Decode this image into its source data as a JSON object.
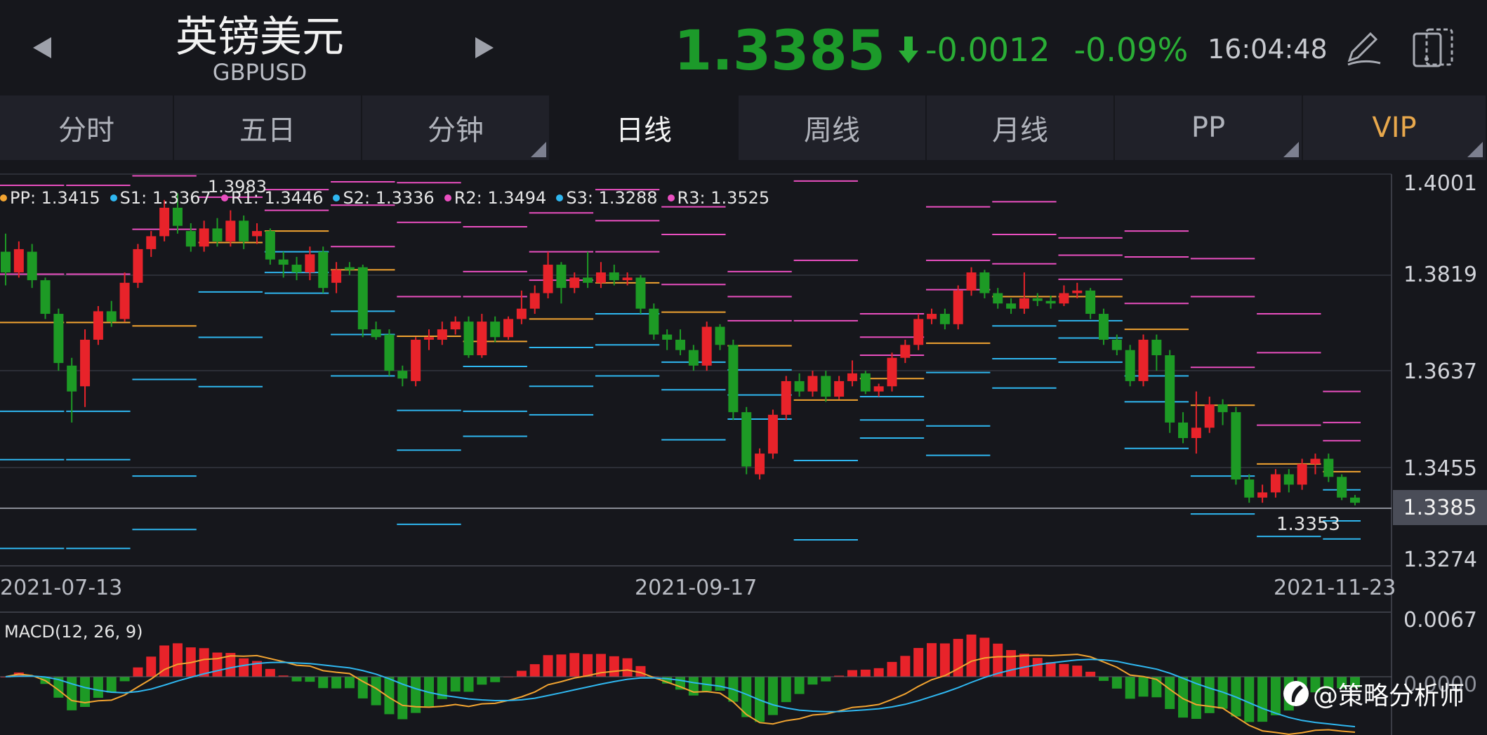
{
  "header": {
    "title": "英镑美元",
    "symbol": "GBPUSD",
    "price": "1.3385",
    "change": "-0.0012",
    "change_pct": "-0.09%",
    "time": "16:04:48"
  },
  "tabs": [
    {
      "label": "分时",
      "corner": false
    },
    {
      "label": "五日",
      "corner": false
    },
    {
      "label": "分钟",
      "corner": true
    },
    {
      "label": "日线",
      "corner": false,
      "active": true
    },
    {
      "label": "周线",
      "corner": false
    },
    {
      "label": "月线",
      "corner": false
    },
    {
      "label": "PP",
      "corner": true
    },
    {
      "label": "VIP",
      "corner": true
    }
  ],
  "pp_legend": [
    {
      "text": "PP: 1.3415",
      "color": "#f2a431"
    },
    {
      "text": "S1: 1.3367",
      "color": "#2fb7f0"
    },
    {
      "text": "R1: 1.3446",
      "color": "#ea4fc0"
    },
    {
      "text": "S2: 1.3336",
      "color": "#2fb7f0"
    },
    {
      "text": "R2: 1.3494",
      "color": "#ea4fc0"
    },
    {
      "text": "S3: 1.3288",
      "color": "#2fb7f0"
    },
    {
      "text": "R3: 1.3525",
      "color": "#ea4fc0"
    }
  ],
  "price_axis": [
    "1.4001",
    "1.3819",
    "1.3637",
    "1.3455",
    "1.3274"
  ],
  "current_price_label": "1.3385",
  "high_label": "1.3983",
  "low_label": "1.3353",
  "date_ticks": [
    "2021-07-13",
    "2021-09-17",
    "2021-11-23"
  ],
  "macd": {
    "label": "MACD(12, 26, 9)",
    "axis_top": "0.0067",
    "axis_zero": "0.0000"
  },
  "watermark": "@策略分析师",
  "colors": {
    "up": "#e8232a",
    "down": "#1d9a25",
    "pp": "#f2a431",
    "support": "#2fb7f0",
    "resistance": "#ea4fc0",
    "price_green": "#1c9a2a"
  },
  "chart_data": {
    "type": "candlestick",
    "ylim": [
      1.3274,
      1.4001
    ],
    "candles": [
      [
        1.387,
        1.383,
        1.3905,
        1.3805
      ],
      [
        1.383,
        1.3875,
        1.389,
        1.382
      ],
      [
        1.387,
        1.3815,
        1.3885,
        1.38
      ],
      [
        1.3815,
        1.375,
        1.382,
        1.374
      ],
      [
        1.375,
        1.3655,
        1.376,
        1.364
      ],
      [
        1.365,
        1.36,
        1.3665,
        1.354
      ],
      [
        1.361,
        1.37,
        1.372,
        1.357
      ],
      [
        1.37,
        1.3755,
        1.3765,
        1.369
      ],
      [
        1.3755,
        1.3735,
        1.3775,
        1.3725
      ],
      [
        1.374,
        1.381,
        1.383,
        1.3735
      ],
      [
        1.381,
        1.3875,
        1.3885,
        1.38
      ],
      [
        1.3875,
        1.39,
        1.391,
        1.386
      ],
      [
        1.39,
        1.3955,
        1.397,
        1.389
      ],
      [
        1.3955,
        1.392,
        1.3983,
        1.3905
      ],
      [
        1.391,
        1.388,
        1.3925,
        1.387
      ],
      [
        1.388,
        1.3915,
        1.393,
        1.387
      ],
      [
        1.3915,
        1.389,
        1.3935,
        1.388
      ],
      [
        1.389,
        1.393,
        1.395,
        1.388
      ],
      [
        1.393,
        1.389,
        1.394,
        1.3875
      ],
      [
        1.39,
        1.391,
        1.3925,
        1.3885
      ],
      [
        1.391,
        1.3855,
        1.3915,
        1.3845
      ],
      [
        1.3855,
        1.3845,
        1.387,
        1.382
      ],
      [
        1.3845,
        1.383,
        1.386,
        1.3815
      ],
      [
        1.383,
        1.3865,
        1.388,
        1.3815
      ],
      [
        1.387,
        1.38,
        1.388,
        1.379
      ],
      [
        1.381,
        1.3835,
        1.385,
        1.379
      ],
      [
        1.384,
        1.3835,
        1.385,
        1.3825
      ],
      [
        1.384,
        1.372,
        1.3845,
        1.3705
      ],
      [
        1.372,
        1.3705,
        1.3735,
        1.37
      ],
      [
        1.371,
        1.364,
        1.372,
        1.363
      ],
      [
        1.364,
        1.3625,
        1.365,
        1.361
      ],
      [
        1.362,
        1.37,
        1.3705,
        1.361
      ],
      [
        1.37,
        1.3705,
        1.372,
        1.368
      ],
      [
        1.37,
        1.372,
        1.3735,
        1.369
      ],
      [
        1.372,
        1.3735,
        1.3745,
        1.371
      ],
      [
        1.3735,
        1.367,
        1.3745,
        1.3665
      ],
      [
        1.367,
        1.3735,
        1.375,
        1.3665
      ],
      [
        1.3735,
        1.3705,
        1.3745,
        1.3695
      ],
      [
        1.3705,
        1.374,
        1.3745,
        1.37
      ],
      [
        1.374,
        1.376,
        1.3795,
        1.373
      ],
      [
        1.376,
        1.379,
        1.3805,
        1.375
      ],
      [
        1.379,
        1.3845,
        1.387,
        1.378
      ],
      [
        1.3845,
        1.38,
        1.385,
        1.377
      ],
      [
        1.38,
        1.382,
        1.383,
        1.379
      ],
      [
        1.382,
        1.381,
        1.387,
        1.38
      ],
      [
        1.381,
        1.383,
        1.385,
        1.38
      ],
      [
        1.383,
        1.3815,
        1.3845,
        1.3805
      ],
      [
        1.3815,
        1.382,
        1.383,
        1.3805
      ],
      [
        1.382,
        1.376,
        1.3825,
        1.375
      ],
      [
        1.376,
        1.371,
        1.377,
        1.37
      ],
      [
        1.371,
        1.37,
        1.372,
        1.368
      ],
      [
        1.37,
        1.368,
        1.372,
        1.367
      ],
      [
        1.368,
        1.365,
        1.369,
        1.364
      ],
      [
        1.365,
        1.3725,
        1.3735,
        1.364
      ],
      [
        1.3725,
        1.369,
        1.373,
        1.368
      ],
      [
        1.369,
        1.356,
        1.37,
        1.3545
      ],
      [
        1.356,
        1.3455,
        1.357,
        1.344
      ],
      [
        1.344,
        1.348,
        1.349,
        1.343
      ],
      [
        1.348,
        1.3555,
        1.3565,
        1.347
      ],
      [
        1.3555,
        1.362,
        1.363,
        1.3545
      ],
      [
        1.362,
        1.36,
        1.3635,
        1.359
      ],
      [
        1.36,
        1.363,
        1.364,
        1.359
      ],
      [
        1.363,
        1.359,
        1.364,
        1.358
      ],
      [
        1.359,
        1.362,
        1.363,
        1.3585
      ],
      [
        1.362,
        1.3635,
        1.366,
        1.361
      ],
      [
        1.3635,
        1.36,
        1.364,
        1.3595
      ],
      [
        1.36,
        1.361,
        1.3615,
        1.359
      ],
      [
        1.361,
        1.3665,
        1.3675,
        1.36
      ],
      [
        1.3665,
        1.369,
        1.37,
        1.3655
      ],
      [
        1.369,
        1.374,
        1.375,
        1.368
      ],
      [
        1.374,
        1.375,
        1.376,
        1.373
      ],
      [
        1.375,
        1.373,
        1.376,
        1.372
      ],
      [
        1.373,
        1.3795,
        1.3805,
        1.372
      ],
      [
        1.3795,
        1.383,
        1.384,
        1.3785
      ],
      [
        1.383,
        1.379,
        1.3835,
        1.378
      ],
      [
        1.379,
        1.377,
        1.38,
        1.376
      ],
      [
        1.377,
        1.376,
        1.378,
        1.375
      ],
      [
        1.376,
        1.378,
        1.383,
        1.375
      ],
      [
        1.378,
        1.3775,
        1.379,
        1.3765
      ],
      [
        1.3775,
        1.377,
        1.3785,
        1.376
      ],
      [
        1.377,
        1.379,
        1.3805,
        1.3765
      ],
      [
        1.379,
        1.3795,
        1.381,
        1.378
      ],
      [
        1.3795,
        1.375,
        1.38,
        1.374
      ],
      [
        1.375,
        1.37,
        1.376,
        1.369
      ],
      [
        1.37,
        1.368,
        1.371,
        1.367
      ],
      [
        1.368,
        1.362,
        1.369,
        1.361
      ],
      [
        1.362,
        1.37,
        1.371,
        1.361
      ],
      [
        1.37,
        1.367,
        1.371,
        1.364
      ],
      [
        1.367,
        1.354,
        1.368,
        1.352
      ],
      [
        1.354,
        1.351,
        1.356,
        1.35
      ],
      [
        1.351,
        1.353,
        1.36,
        1.348
      ],
      [
        1.353,
        1.3575,
        1.359,
        1.352
      ],
      [
        1.3575,
        1.356,
        1.3585,
        1.3535
      ],
      [
        1.356,
        1.343,
        1.357,
        1.342
      ],
      [
        1.343,
        1.3395,
        1.344,
        1.3385
      ],
      [
        1.3395,
        1.3405,
        1.342,
        1.3385
      ],
      [
        1.3405,
        1.344,
        1.345,
        1.3395
      ],
      [
        1.344,
        1.342,
        1.345,
        1.3405
      ],
      [
        1.342,
        1.346,
        1.347,
        1.341
      ],
      [
        1.346,
        1.347,
        1.348,
        1.344
      ],
      [
        1.347,
        1.3435,
        1.348,
        1.3425
      ],
      [
        1.3435,
        1.3395,
        1.344,
        1.339
      ],
      [
        1.3395,
        1.3385,
        1.34,
        1.338
      ]
    ]
  }
}
